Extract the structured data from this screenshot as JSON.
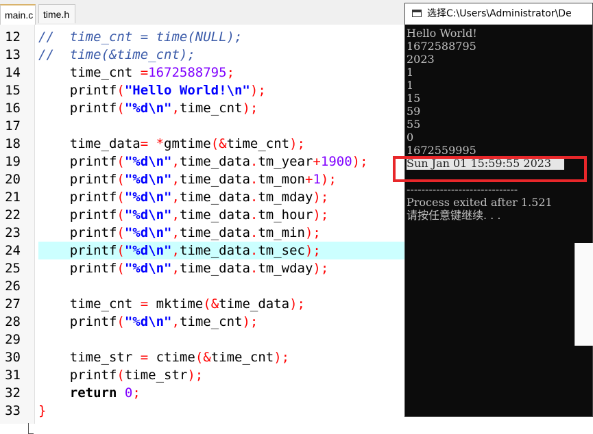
{
  "tabs": [
    {
      "label": "main.c",
      "active": true
    },
    {
      "label": "time.h",
      "active": false
    }
  ],
  "editor": {
    "highlighted_line": "24",
    "lines": [
      {
        "num": "12",
        "segments": [
          {
            "t": "//  time_cnt = time(NULL);",
            "c": "cmt"
          }
        ]
      },
      {
        "num": "13",
        "segments": [
          {
            "t": "//  time(&time_cnt);",
            "c": "cmt"
          }
        ]
      },
      {
        "num": "14",
        "segments": [
          {
            "t": "    time_cnt ",
            "c": ""
          },
          {
            "t": "=",
            "c": "op"
          },
          {
            "t": "1672588795",
            "c": "num"
          },
          {
            "t": ";",
            "c": "op"
          }
        ]
      },
      {
        "num": "15",
        "segments": [
          {
            "t": "    printf",
            "c": ""
          },
          {
            "t": "(",
            "c": "op"
          },
          {
            "t": "\"Hello World!\\n\"",
            "c": "str"
          },
          {
            "t": ");",
            "c": "op"
          }
        ]
      },
      {
        "num": "16",
        "segments": [
          {
            "t": "    printf",
            "c": ""
          },
          {
            "t": "(",
            "c": "op"
          },
          {
            "t": "\"%d\\n\"",
            "c": "str"
          },
          {
            "t": ",",
            "c": "op"
          },
          {
            "t": "time_cnt",
            "c": ""
          },
          {
            "t": ");",
            "c": "op"
          }
        ]
      },
      {
        "num": "17",
        "segments": []
      },
      {
        "num": "18",
        "segments": [
          {
            "t": "    time_data",
            "c": ""
          },
          {
            "t": "= *",
            "c": "op"
          },
          {
            "t": "gmtime",
            "c": ""
          },
          {
            "t": "(&",
            "c": "op"
          },
          {
            "t": "time_cnt",
            "c": ""
          },
          {
            "t": ");",
            "c": "op"
          }
        ]
      },
      {
        "num": "19",
        "segments": [
          {
            "t": "    printf",
            "c": ""
          },
          {
            "t": "(",
            "c": "op"
          },
          {
            "t": "\"%d\\n\"",
            "c": "str"
          },
          {
            "t": ",",
            "c": "op"
          },
          {
            "t": "time_data",
            "c": ""
          },
          {
            "t": ".",
            "c": "op"
          },
          {
            "t": "tm_year",
            "c": ""
          },
          {
            "t": "+",
            "c": "op"
          },
          {
            "t": "1900",
            "c": "num"
          },
          {
            "t": ");",
            "c": "op"
          }
        ]
      },
      {
        "num": "20",
        "segments": [
          {
            "t": "    printf",
            "c": ""
          },
          {
            "t": "(",
            "c": "op"
          },
          {
            "t": "\"%d\\n\"",
            "c": "str"
          },
          {
            "t": ",",
            "c": "op"
          },
          {
            "t": "time_data",
            "c": ""
          },
          {
            "t": ".",
            "c": "op"
          },
          {
            "t": "tm_mon",
            "c": ""
          },
          {
            "t": "+",
            "c": "op"
          },
          {
            "t": "1",
            "c": "num"
          },
          {
            "t": ");",
            "c": "op"
          }
        ]
      },
      {
        "num": "21",
        "segments": [
          {
            "t": "    printf",
            "c": ""
          },
          {
            "t": "(",
            "c": "op"
          },
          {
            "t": "\"%d\\n\"",
            "c": "str"
          },
          {
            "t": ",",
            "c": "op"
          },
          {
            "t": "time_data",
            "c": ""
          },
          {
            "t": ".",
            "c": "op"
          },
          {
            "t": "tm_mday",
            "c": ""
          },
          {
            "t": ");",
            "c": "op"
          }
        ]
      },
      {
        "num": "22",
        "segments": [
          {
            "t": "    printf",
            "c": ""
          },
          {
            "t": "(",
            "c": "op"
          },
          {
            "t": "\"%d\\n\"",
            "c": "str"
          },
          {
            "t": ",",
            "c": "op"
          },
          {
            "t": "time_data",
            "c": ""
          },
          {
            "t": ".",
            "c": "op"
          },
          {
            "t": "tm_hour",
            "c": ""
          },
          {
            "t": ");",
            "c": "op"
          }
        ]
      },
      {
        "num": "23",
        "segments": [
          {
            "t": "    printf",
            "c": ""
          },
          {
            "t": "(",
            "c": "op"
          },
          {
            "t": "\"%d\\n\"",
            "c": "str"
          },
          {
            "t": ",",
            "c": "op"
          },
          {
            "t": "time_data",
            "c": ""
          },
          {
            "t": ".",
            "c": "op"
          },
          {
            "t": "tm_min",
            "c": ""
          },
          {
            "t": ");",
            "c": "op"
          }
        ]
      },
      {
        "num": "24",
        "segments": [
          {
            "t": "    printf",
            "c": ""
          },
          {
            "t": "(",
            "c": "op"
          },
          {
            "t": "\"%d\\n\"",
            "c": "str"
          },
          {
            "t": ",",
            "c": "op"
          },
          {
            "t": "time_data",
            "c": ""
          },
          {
            "t": ".",
            "c": "op"
          },
          {
            "t": "tm_sec",
            "c": ""
          },
          {
            "t": ");",
            "c": "op"
          }
        ]
      },
      {
        "num": "25",
        "segments": [
          {
            "t": "    printf",
            "c": ""
          },
          {
            "t": "(",
            "c": "op"
          },
          {
            "t": "\"%d\\n\"",
            "c": "str"
          },
          {
            "t": ",",
            "c": "op"
          },
          {
            "t": "time_data",
            "c": ""
          },
          {
            "t": ".",
            "c": "op"
          },
          {
            "t": "tm_wday",
            "c": ""
          },
          {
            "t": ");",
            "c": "op"
          }
        ]
      },
      {
        "num": "26",
        "segments": []
      },
      {
        "num": "27",
        "segments": [
          {
            "t": "    time_cnt ",
            "c": ""
          },
          {
            "t": "=",
            "c": "op"
          },
          {
            "t": " mktime",
            "c": ""
          },
          {
            "t": "(&",
            "c": "op"
          },
          {
            "t": "time_data",
            "c": ""
          },
          {
            "t": ");",
            "c": "op"
          }
        ]
      },
      {
        "num": "28",
        "segments": [
          {
            "t": "    printf",
            "c": ""
          },
          {
            "t": "(",
            "c": "op"
          },
          {
            "t": "\"%d\\n\"",
            "c": "str"
          },
          {
            "t": ",",
            "c": "op"
          },
          {
            "t": "time_cnt",
            "c": ""
          },
          {
            "t": ");",
            "c": "op"
          }
        ]
      },
      {
        "num": "29",
        "segments": []
      },
      {
        "num": "30",
        "segments": [
          {
            "t": "    time_str ",
            "c": ""
          },
          {
            "t": "=",
            "c": "op"
          },
          {
            "t": " ctime",
            "c": ""
          },
          {
            "t": "(&",
            "c": "op"
          },
          {
            "t": "time_cnt",
            "c": ""
          },
          {
            "t": ");",
            "c": "op"
          }
        ]
      },
      {
        "num": "31",
        "segments": [
          {
            "t": "    printf",
            "c": ""
          },
          {
            "t": "(",
            "c": "op"
          },
          {
            "t": "time_str",
            "c": ""
          },
          {
            "t": ");",
            "c": "op"
          }
        ]
      },
      {
        "num": "32",
        "segments": [
          {
            "t": "    ",
            "c": ""
          },
          {
            "t": "return",
            "c": "kw"
          },
          {
            "t": " ",
            "c": ""
          },
          {
            "t": "0",
            "c": "num"
          },
          {
            "t": ";",
            "c": "op"
          }
        ]
      },
      {
        "num": "33",
        "segments": [
          {
            "t": "}",
            "c": "op"
          }
        ]
      }
    ]
  },
  "console": {
    "title": "选择C:\\Users\\Administrator\\De",
    "lines": [
      "Hello World!",
      "1672588795",
      "2023",
      "1",
      "1",
      "15",
      "59",
      "55",
      "0",
      "1672559995",
      "Sun Jan 01 15:59:55 2023",
      "",
      "------------------------------",
      "Process exited after 1.521",
      "请按任意键继续. . ."
    ],
    "selected_line": 10
  },
  "colors": {
    "highlight": "#ccffff",
    "annotation": "#e8272a",
    "string": "#0000ff",
    "number": "#8000ff",
    "operator": "#ff0000",
    "comment": "#3b5ba9"
  }
}
